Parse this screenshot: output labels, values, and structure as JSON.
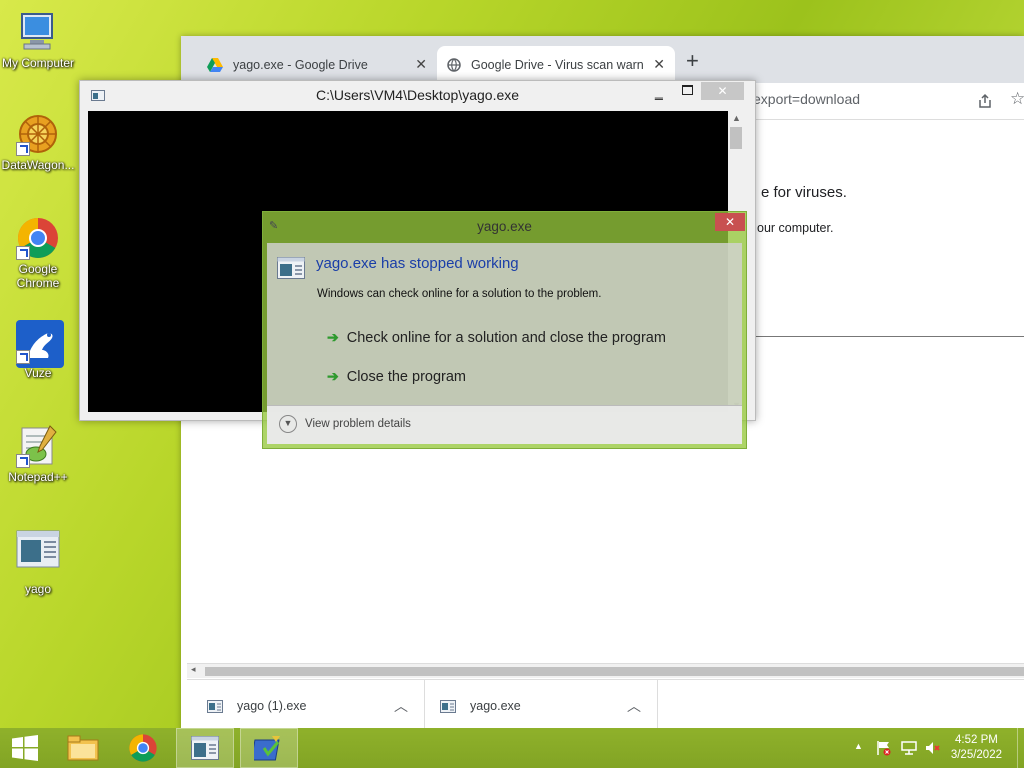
{
  "desktop": {
    "icons": [
      {
        "label": "My Computer"
      },
      {
        "label": "DataWagon..."
      },
      {
        "label": "Google Chrome"
      },
      {
        "label": "Vuze"
      },
      {
        "label": "Notepad++"
      },
      {
        "label": "yago"
      }
    ]
  },
  "browser": {
    "tabs": [
      {
        "title": "yago.exe - Google Drive"
      },
      {
        "title": "Google Drive - Virus scan warnin"
      }
    ],
    "new_tab": "+",
    "url_fragment": "export=download",
    "page_text_1": "e for viruses.",
    "page_text_2": "our computer.",
    "downloads": [
      {
        "name": "yago (1).exe"
      },
      {
        "name": "yago.exe"
      }
    ]
  },
  "console": {
    "title": "C:\\Users\\VM4\\Desktop\\yago.exe"
  },
  "error_dialog": {
    "title": "yago.exe",
    "heading": "yago.exe has stopped working",
    "message": "Windows can check online for a solution to the problem.",
    "option_1": "Check online for a solution and close the program",
    "option_2": "Close the program",
    "details": "View problem details",
    "close_glyph": "✕"
  },
  "taskbar": {
    "time": "4:52 PM",
    "date": "3/25/2022"
  },
  "colors": {
    "link_blue": "#1a3ea8",
    "arrow_green": "#2e9a2e"
  }
}
